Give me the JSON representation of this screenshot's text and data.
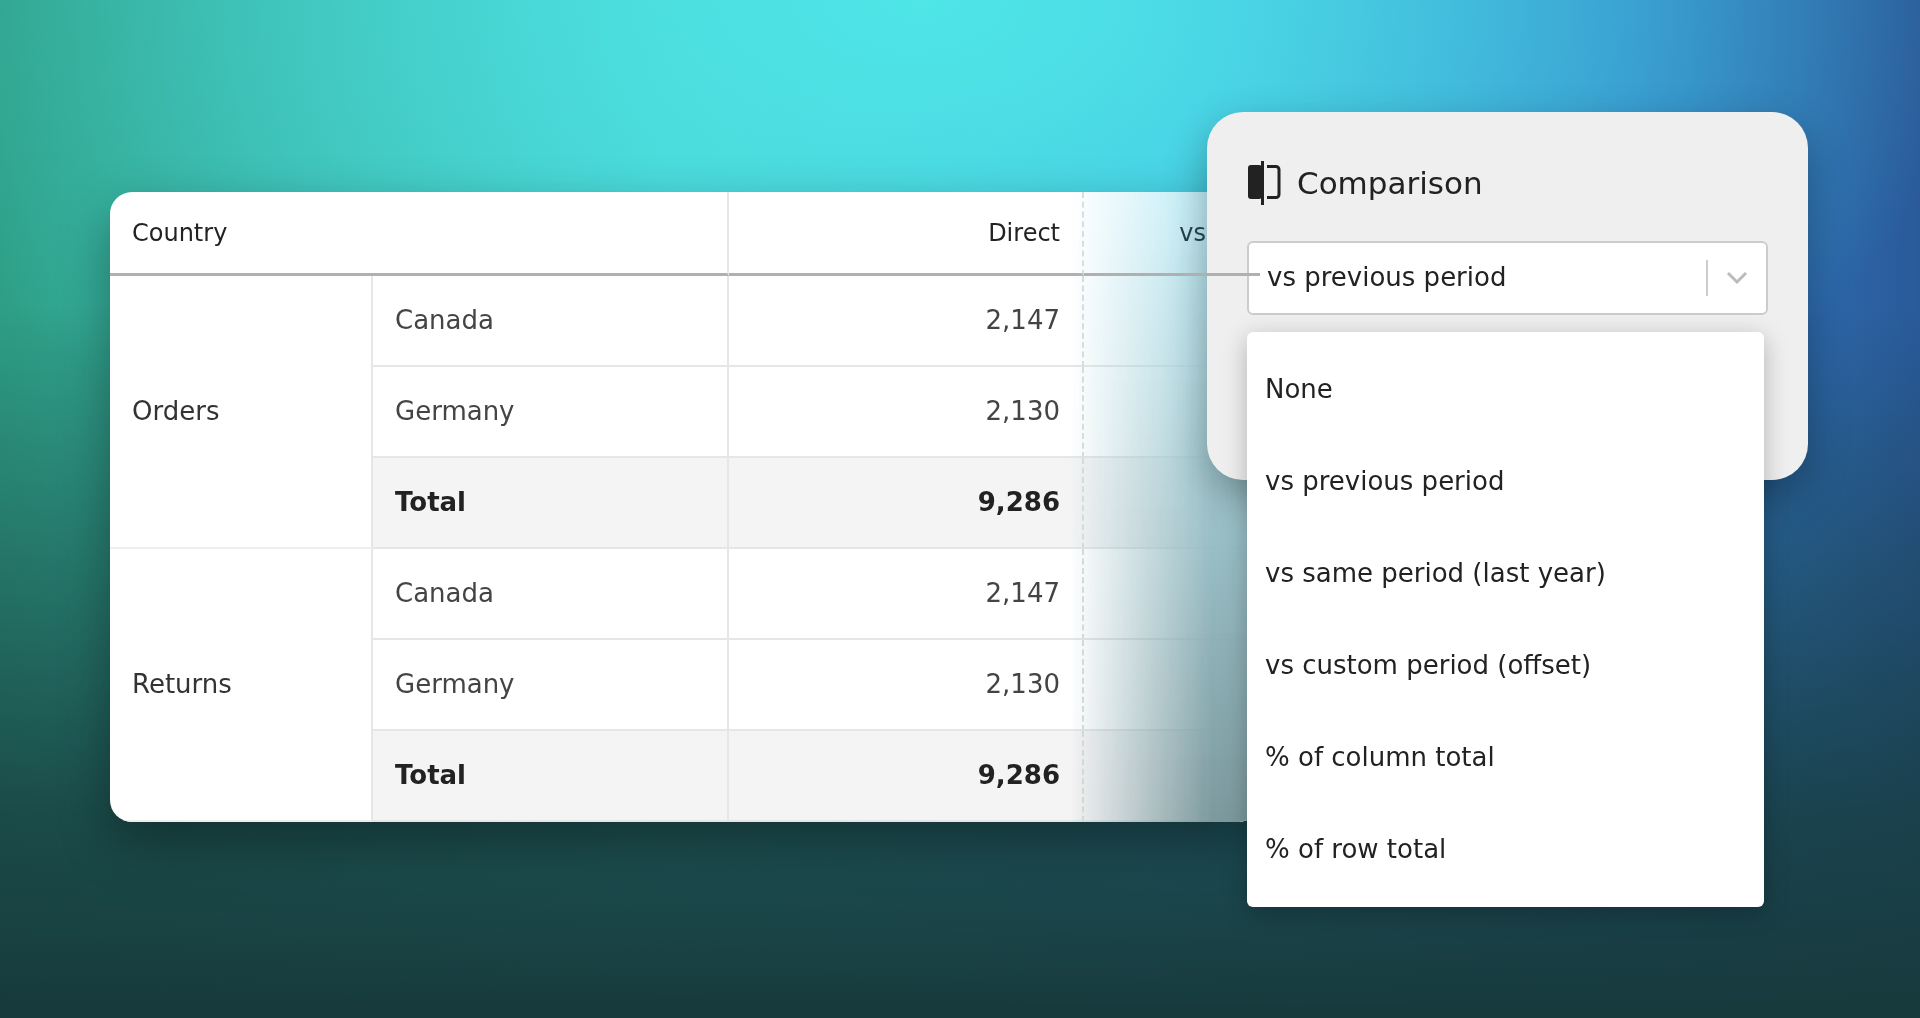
{
  "table": {
    "columns": [
      "Country",
      "Direct",
      "vs"
    ],
    "groups": [
      {
        "label": "Orders",
        "rows": [
          {
            "kind": "detail",
            "country": "Canada",
            "direct": "2,147"
          },
          {
            "kind": "detail",
            "country": "Germany",
            "direct": "2,130"
          },
          {
            "kind": "total",
            "country": "Total",
            "direct": "9,286"
          }
        ]
      },
      {
        "label": "Returns",
        "rows": [
          {
            "kind": "detail",
            "country": "Canada",
            "direct": "2,147"
          },
          {
            "kind": "detail",
            "country": "Germany",
            "direct": "2,130"
          },
          {
            "kind": "total",
            "country": "Total",
            "direct": "9,286"
          }
        ]
      }
    ]
  },
  "comparison_panel": {
    "title": "Comparison",
    "select": {
      "value": "vs previous period"
    },
    "options": [
      "None",
      "vs previous period",
      "vs same period (last year)",
      "vs custom period (offset)",
      "% of column total",
      "% of row total"
    ]
  }
}
